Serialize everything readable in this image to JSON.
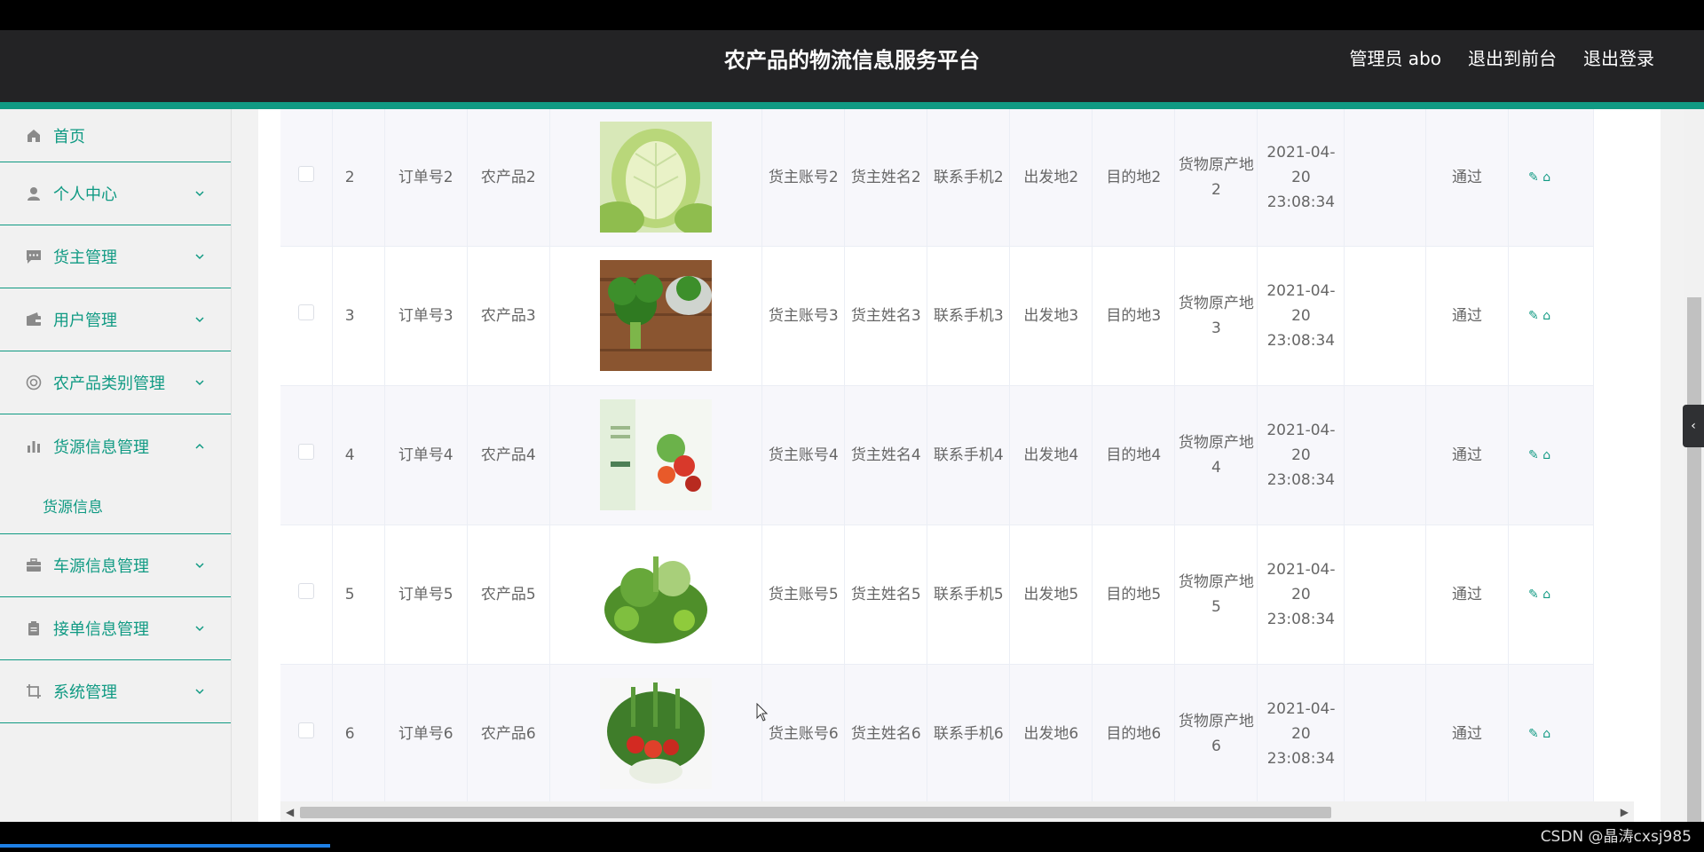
{
  "header": {
    "title": "农产品的物流信息服务平台",
    "links": [
      "管理员 abo",
      "退出到前台",
      "退出登录"
    ]
  },
  "sidebar": {
    "items": [
      {
        "label": "首页",
        "icon": "home-icon"
      },
      {
        "label": "个人中心",
        "icon": "user-icon"
      },
      {
        "label": "货主管理",
        "icon": "chat-icon"
      },
      {
        "label": "用户管理",
        "icon": "wallet-icon"
      },
      {
        "label": "农产品类别管理",
        "icon": "lifebuoy-icon"
      },
      {
        "label": "货源信息管理",
        "icon": "bar-chart-icon"
      },
      {
        "label": "车源信息管理",
        "icon": "briefcase-icon"
      },
      {
        "label": "接单信息管理",
        "icon": "clipboard-icon"
      },
      {
        "label": "系统管理",
        "icon": "crop-icon"
      }
    ],
    "submenu": {
      "label": "货源信息"
    }
  },
  "table": {
    "rows": [
      {
        "index": "2",
        "order": "订单号2",
        "product": "农产品2",
        "owner_account": "货主账号2",
        "owner_name": "货主姓名2",
        "phone": "联系手机2",
        "departure": "出发地2",
        "destination": "目的地2",
        "origin": "货物原产地2",
        "time": "2021-04-20 23:08:34",
        "status": "通过"
      },
      {
        "index": "3",
        "order": "订单号3",
        "product": "农产品3",
        "owner_account": "货主账号3",
        "owner_name": "货主姓名3",
        "phone": "联系手机3",
        "departure": "出发地3",
        "destination": "目的地3",
        "origin": "货物原产地3",
        "time": "2021-04-20 23:08:34",
        "status": "通过"
      },
      {
        "index": "4",
        "order": "订单号4",
        "product": "农产品4",
        "owner_account": "货主账号4",
        "owner_name": "货主姓名4",
        "phone": "联系手机4",
        "departure": "出发地4",
        "destination": "目的地4",
        "origin": "货物原产地4",
        "time": "2021-04-20 23:08:34",
        "status": "通过"
      },
      {
        "index": "5",
        "order": "订单号5",
        "product": "农产品5",
        "owner_account": "货主账号5",
        "owner_name": "货主姓名5",
        "phone": "联系手机5",
        "departure": "出发地5",
        "destination": "目的地5",
        "origin": "货物原产地5",
        "time": "2021-04-20 23:08:34",
        "status": "通过"
      },
      {
        "index": "6",
        "order": "订单号6",
        "product": "农产品6",
        "owner_account": "货主账号6",
        "owner_name": "货主姓名6",
        "phone": "联系手机6",
        "departure": "出发地6",
        "destination": "目的地6",
        "origin": "货物原产地6",
        "time": "2021-04-20 23:08:34",
        "status": "通过"
      }
    ]
  },
  "watermark": "CSDN @晶涛cxsj985",
  "colors": {
    "accent": "#109a83",
    "header_bg": "#232325"
  }
}
